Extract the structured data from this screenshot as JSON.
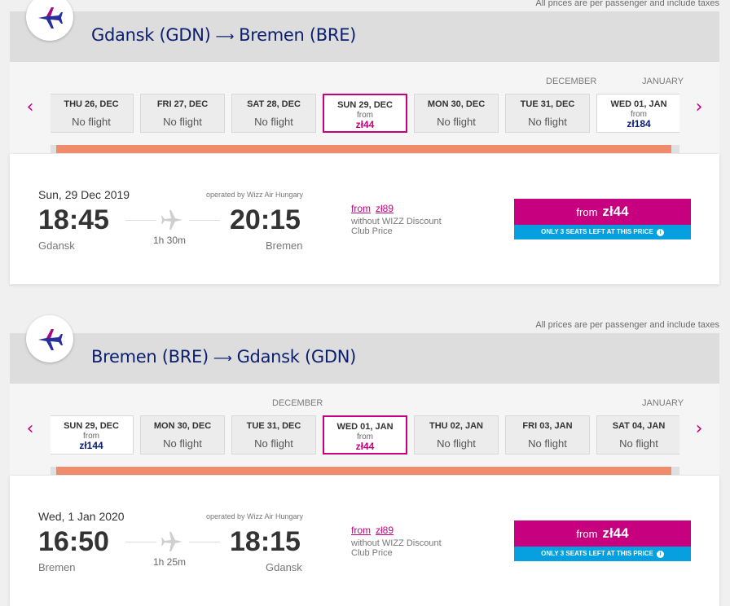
{
  "price_note": "All prices are per passenger and include taxes",
  "colors": {
    "accent": "#c6007e",
    "navy": "#0b1f6e",
    "seats": "#06a0e0",
    "bar": "#f08c6b"
  },
  "sections": [
    {
      "route": {
        "from": "Gdansk (GDN)",
        "arrow": "⟶",
        "to": "Bremen (BRE)"
      },
      "months": [
        "DECEMBER",
        "JANUARY"
      ],
      "dates": [
        {
          "label": "THU 26, DEC",
          "status": "No flight"
        },
        {
          "label": "FRI 27, DEC",
          "status": "No flight"
        },
        {
          "label": "SAT 28, DEC",
          "status": "No flight"
        },
        {
          "label": "SUN 29, DEC",
          "from": "from",
          "price": "zł44",
          "selected": true
        },
        {
          "label": "MON 30, DEC",
          "status": "No flight"
        },
        {
          "label": "TUE 31, DEC",
          "status": "No flight"
        },
        {
          "label": "WED 01, JAN",
          "from": "from",
          "price": "zł184"
        }
      ],
      "flight": {
        "date": "Sun, 29 Dec 2019",
        "operator": "operated by Wizz Air Hungary",
        "dep_time": "18:45",
        "arr_time": "20:15",
        "dep_city": "Gdansk",
        "arr_city": "Bremen",
        "duration": "1h 30m",
        "alt_from": "from",
        "alt_price": "zł89",
        "club_note": "without WIZZ Discount Club Price",
        "btn_from": "from",
        "btn_price": "zł44",
        "seats_note": "ONLY 3 SEATS LEFT AT THIS PRICE",
        "info_icon": "i"
      }
    },
    {
      "route": {
        "from": "Bremen (BRE)",
        "arrow": "⟶",
        "to": "Gdansk (GDN)"
      },
      "months": [
        "DECEMBER",
        "JANUARY"
      ],
      "dates": [
        {
          "label": "SUN 29, DEC",
          "from": "from",
          "price": "zł144"
        },
        {
          "label": "MON 30, DEC",
          "status": "No flight"
        },
        {
          "label": "TUE 31, DEC",
          "status": "No flight"
        },
        {
          "label": "WED 01, JAN",
          "from": "from",
          "price": "zł44",
          "selected": true
        },
        {
          "label": "THU 02, JAN",
          "status": "No flight"
        },
        {
          "label": "FRI 03, JAN",
          "status": "No flight"
        },
        {
          "label": "SAT 04, JAN",
          "status": "No flight"
        }
      ],
      "flight": {
        "date": "Wed, 1 Jan 2020",
        "operator": "operated by Wizz Air Hungary",
        "dep_time": "16:50",
        "arr_time": "18:15",
        "dep_city": "Bremen",
        "arr_city": "Gdansk",
        "duration": "1h 25m",
        "alt_from": "from",
        "alt_price": "zł89",
        "club_note": "without WIZZ Discount Club Price",
        "btn_from": "from",
        "btn_price": "zł44",
        "seats_note": "ONLY 3 SEATS LEFT AT THIS PRICE",
        "info_icon": "i"
      }
    }
  ]
}
